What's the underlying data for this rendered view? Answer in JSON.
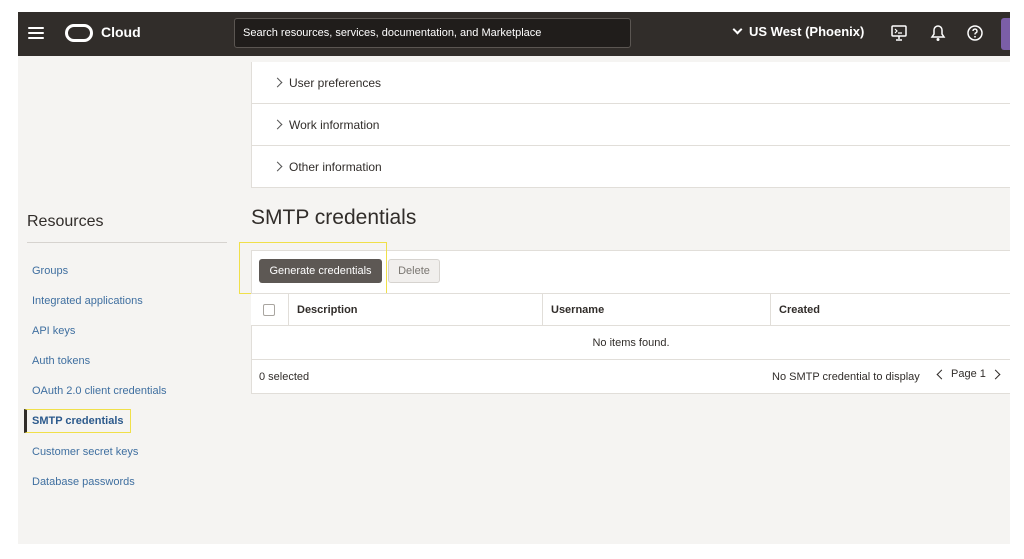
{
  "header": {
    "brand": "Cloud",
    "search_placeholder": "Search resources, services, documentation, and Marketplace",
    "region": "US West (Phoenix)"
  },
  "accordion": [
    {
      "label": "User preferences"
    },
    {
      "label": "Work information"
    },
    {
      "label": "Other information"
    }
  ],
  "sidebar": {
    "title": "Resources",
    "items": [
      {
        "label": "Groups"
      },
      {
        "label": "Integrated applications"
      },
      {
        "label": "API keys"
      },
      {
        "label": "Auth tokens"
      },
      {
        "label": "OAuth 2.0 client credentials"
      },
      {
        "label": "SMTP credentials",
        "active": true
      },
      {
        "label": "Customer secret keys"
      },
      {
        "label": "Database passwords"
      }
    ]
  },
  "main": {
    "section_title": "SMTP credentials",
    "buttons": {
      "generate": "Generate credentials",
      "delete": "Delete"
    },
    "table": {
      "columns": [
        "Description",
        "Username",
        "Created"
      ],
      "empty_message": "No items found.",
      "selected_count": "0 selected",
      "display_message": "No SMTP credential to display",
      "page_label": "Page 1"
    }
  },
  "icons": [
    "hamburger-icon",
    "oracle-logo-icon",
    "chevron-down-icon",
    "cloud-shell-icon",
    "bell-icon",
    "help-icon"
  ]
}
